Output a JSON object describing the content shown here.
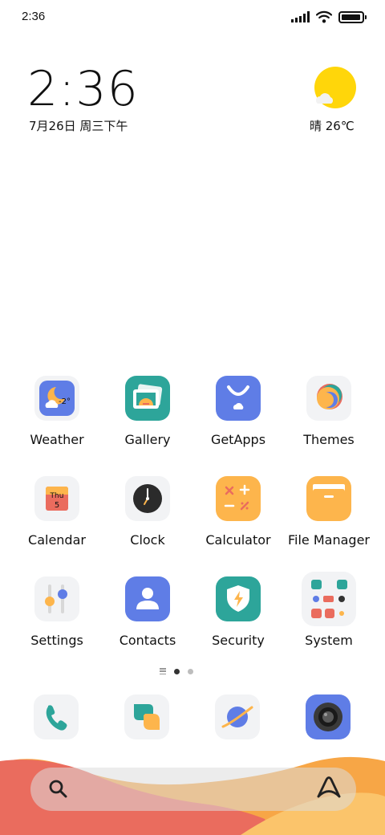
{
  "status_bar": {
    "time": "2:36",
    "signal_icon": "signal-icon",
    "wifi_icon": "wifi-icon",
    "battery_icon": "battery-icon",
    "battery_level": 0.95
  },
  "clock_widget": {
    "time": "2:36",
    "date": "7月26日 周三下午"
  },
  "weather_widget": {
    "icon": "partly-sunny-icon",
    "text": "晴 26℃"
  },
  "apps": [
    {
      "name": "Weather",
      "icon": "weather-icon"
    },
    {
      "name": "Gallery",
      "icon": "gallery-icon"
    },
    {
      "name": "GetApps",
      "icon": "getapps-icon"
    },
    {
      "name": "Themes",
      "icon": "themes-icon"
    },
    {
      "name": "Calendar",
      "icon": "calendar-icon",
      "badge_day": "Thu",
      "badge_date": "5"
    },
    {
      "name": "Clock",
      "icon": "clock-icon"
    },
    {
      "name": "Calculator",
      "icon": "calculator-icon"
    },
    {
      "name": "File Manager",
      "icon": "file-manager-icon"
    },
    {
      "name": "Settings",
      "icon": "settings-icon"
    },
    {
      "name": "Contacts",
      "icon": "contacts-icon"
    },
    {
      "name": "Security",
      "icon": "security-icon"
    },
    {
      "name": "System",
      "icon": "system-folder-icon"
    }
  ],
  "weather_app_badge": "-2°",
  "page_indicator": {
    "pages": 2,
    "current": 1
  },
  "dock": [
    {
      "icon": "phone-icon"
    },
    {
      "icon": "messages-icon"
    },
    {
      "icon": "browser-icon"
    },
    {
      "icon": "camera-icon"
    }
  ],
  "search_bar": {
    "search_icon": "search-icon",
    "assistant_icon": "assistant-icon"
  },
  "colors": {
    "blue_icon": "#5F7DE6",
    "teal_icon": "#2DA59A",
    "orange_icon": "#FDB54C",
    "wave_red": "#EA6C5E",
    "wave_orange": "#F7A646"
  }
}
